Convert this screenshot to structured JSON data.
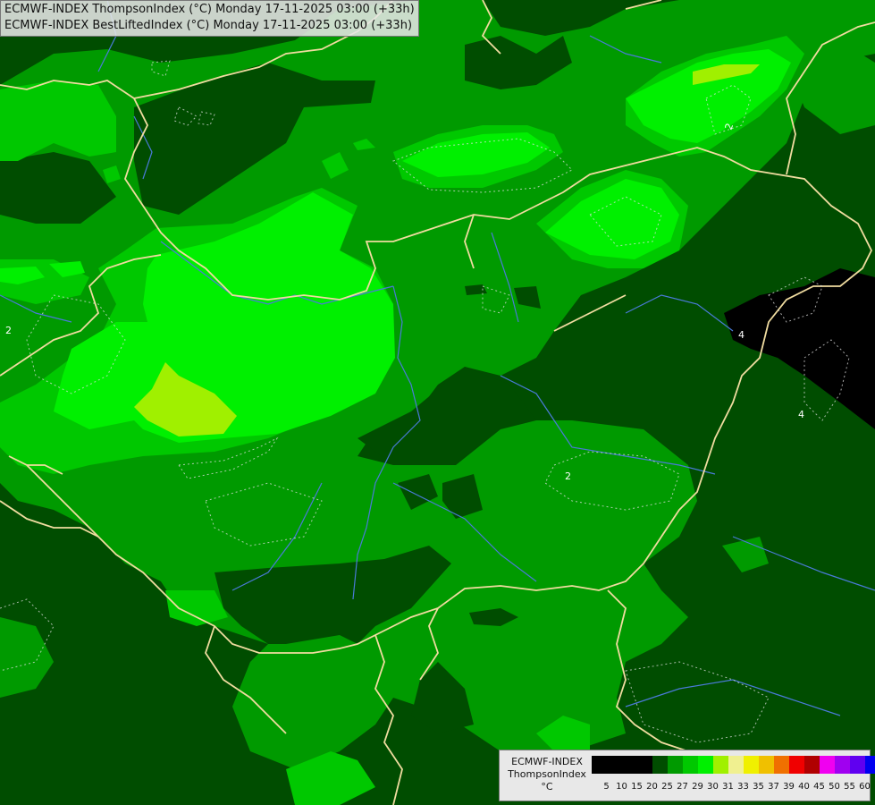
{
  "header": {
    "line1": "ECMWF-INDEX ThompsonIndex (°C) Monday 17-11-2025 03:00 (+33h)",
    "line2": "ECMWF-INDEX BestLiftedIndex (°C) Monday 17-11-2025 03:00 (+33h)"
  },
  "contour_labels": [
    "2",
    "2",
    "2",
    "4",
    "4"
  ],
  "legend": {
    "title_line1": "ECMWF-INDEX",
    "title_line2": "ThompsonIndex",
    "title_line3": "°C",
    "colors": [
      "#000000",
      "#000000",
      "#000000",
      "#000000",
      "#004d00",
      "#009a00",
      "#00c800",
      "#00f000",
      "#a0f000",
      "#f0f090",
      "#f0f000",
      "#f0c000",
      "#f07000",
      "#f00000",
      "#b00000",
      "#f000f0",
      "#a000f0",
      "#6000f0",
      "#0000f0"
    ],
    "ticks": [
      "5",
      "10",
      "15",
      "20",
      "25",
      "27",
      "29",
      "30",
      "31",
      "33",
      "35",
      "37",
      "39",
      "40",
      "45",
      "50",
      "55",
      "60"
    ]
  },
  "colors": {
    "dark": "#004d00",
    "mid": "#009a00",
    "light": "#00c800",
    "bright": "#00f000",
    "yellowgreen": "#a0f000",
    "black": "#000000",
    "border": "#f0dca0",
    "river": "#4a7ad8"
  }
}
